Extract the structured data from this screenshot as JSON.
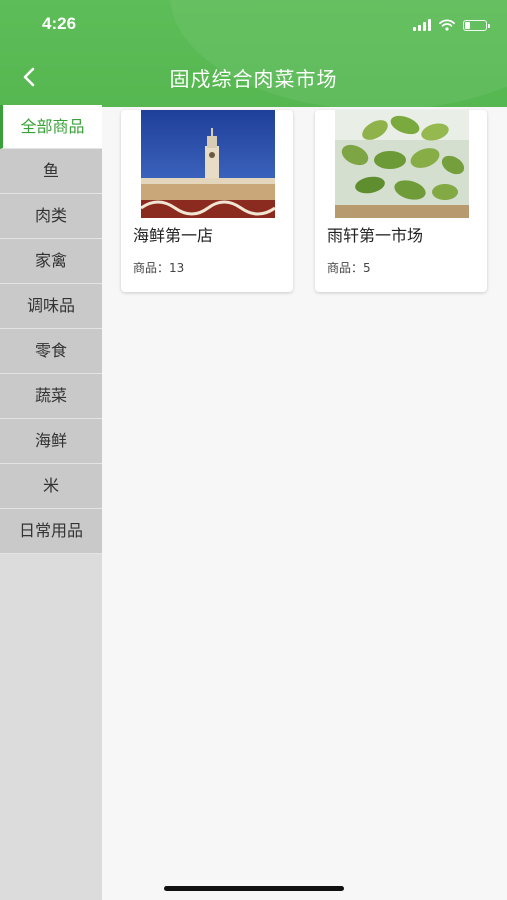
{
  "status": {
    "time": "4:26",
    "battery_level": 0.25
  },
  "header": {
    "title": "固戍综合肉菜市场"
  },
  "categories": [
    {
      "label": "全部商品"
    },
    {
      "label": "鱼"
    },
    {
      "label": "肉类"
    },
    {
      "label": "家禽"
    },
    {
      "label": "调味品"
    },
    {
      "label": "零食"
    },
    {
      "label": "蔬菜"
    },
    {
      "label": "海鲜"
    },
    {
      "label": "米"
    },
    {
      "label": "日常用品"
    }
  ],
  "stores": [
    {
      "name": "海鲜第一店",
      "count": "商品：13"
    },
    {
      "name": "雨轩第一市场",
      "count": "商品：5"
    }
  ],
  "colors": {
    "header": "#5dbd58",
    "accent": "#3aa13a"
  }
}
